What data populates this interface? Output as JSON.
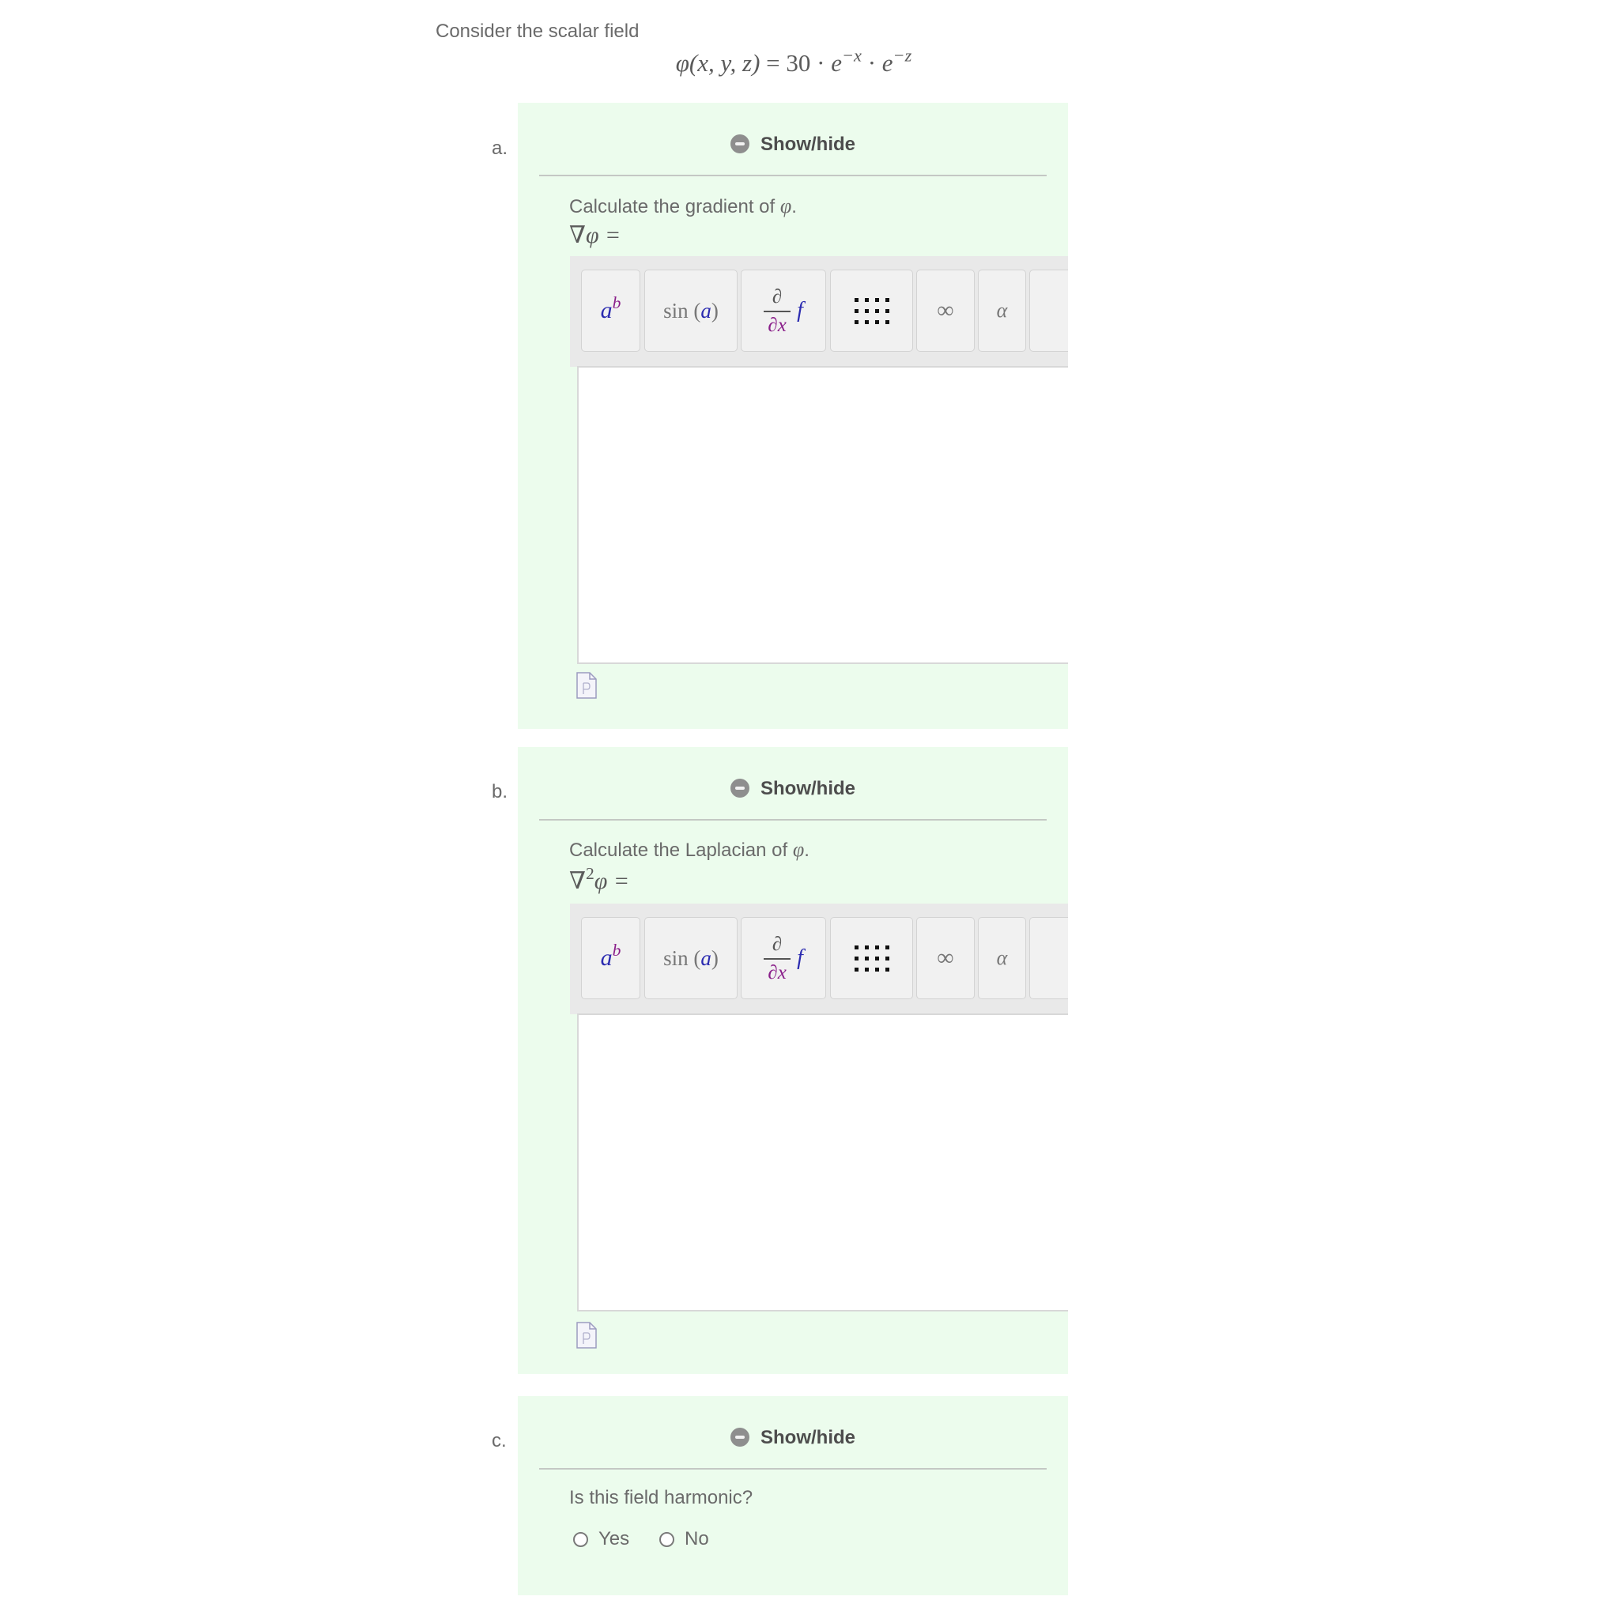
{
  "intro": "Consider the scalar field",
  "formula": {
    "lhs": "φ(x, y, z)",
    "equals": "=",
    "coefficient": "30",
    "dot": "·",
    "base": "e",
    "exp1": "−x",
    "exp2": "−z"
  },
  "parts": [
    {
      "letter": "a.",
      "toggle_label": "Show/hide",
      "prompt_text": "Calculate the gradient of ",
      "prompt_symbol": "φ",
      "prompt_end": ".",
      "operator": "∇φ ="
    },
    {
      "letter": "b.",
      "toggle_label": "Show/hide",
      "prompt_text": "Calculate the Laplacian of ",
      "prompt_symbol": "φ",
      "prompt_end": ".",
      "operator_base": "∇",
      "operator_sup": "2",
      "operator_rest": "φ ="
    },
    {
      "letter": "c.",
      "toggle_label": "Show/hide",
      "question": "Is this field harmonic?",
      "options": [
        "Yes",
        "No"
      ]
    }
  ],
  "toolbar": {
    "power": {
      "base": "a",
      "exp": "b"
    },
    "trig": {
      "fn": "sin",
      "open": "(",
      "arg": "a",
      "close": ")"
    },
    "derivative": {
      "num": "∂",
      "den": "∂x",
      "fn": "f"
    },
    "infinity": "∞",
    "alpha": "α"
  },
  "colors": {
    "panel_bg": "#ecfced",
    "math_blue": "#2b2bb0",
    "math_purple": "#8a1f8a"
  },
  "icons": {
    "toggle": "minus-circle-icon",
    "matrix": "matrix-grid-icon",
    "source": "document-icon"
  }
}
